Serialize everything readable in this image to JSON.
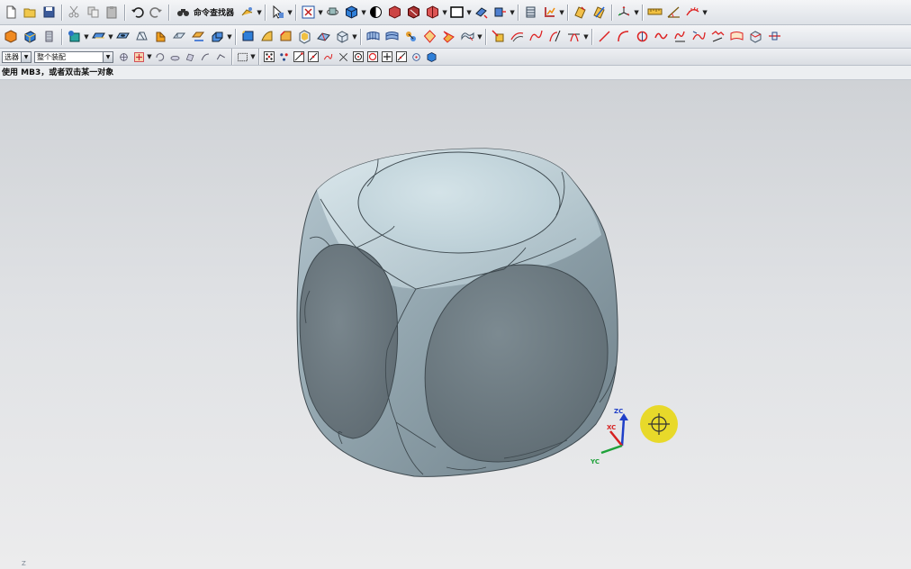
{
  "toolbar1": {
    "command_finder_label": "命令查找器"
  },
  "selection_bar": {
    "filter_value": "选器",
    "scope_value": "整个装配"
  },
  "status": {
    "prompt": "使用 MB3，或者双击某一对象"
  },
  "triad": {
    "z_label": "ZC",
    "x_label": "XC",
    "y_label": "YC"
  },
  "viewport": {
    "corner_mark": "Z"
  },
  "colors": {
    "model_flat_face": "#6f7c84",
    "model_top_face": "#c3d5dc",
    "model_fillet": "#9fb1ba",
    "cursor_highlight": "#e8d820",
    "axis_z": "#1f3fc8",
    "axis_x": "#d62020",
    "axis_y": "#1ea23a"
  }
}
